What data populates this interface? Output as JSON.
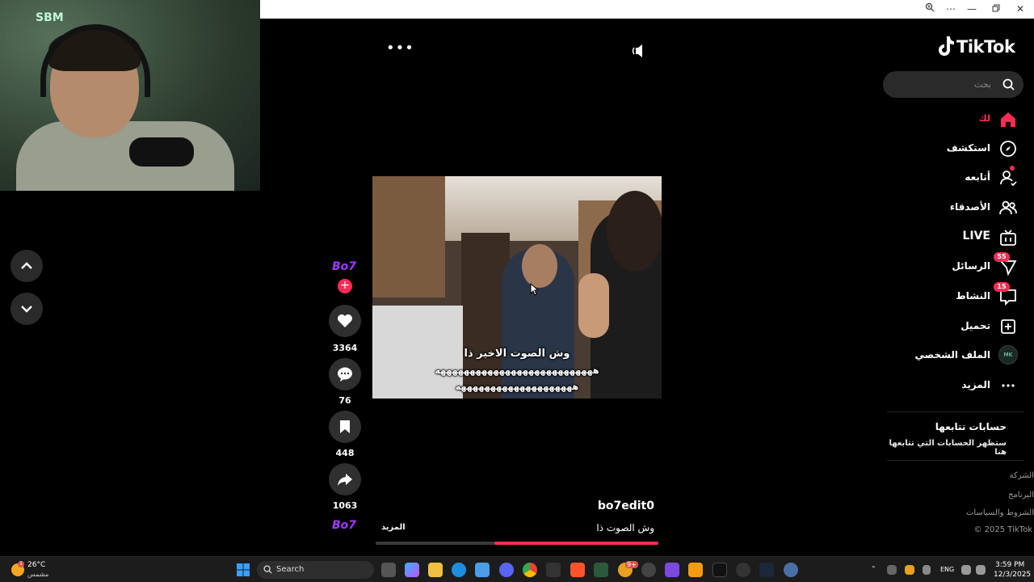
{
  "webcam": {
    "logo_text": "SBM"
  },
  "sidebar": {
    "brand": "TikTok",
    "search_placeholder": "بحث",
    "items": [
      {
        "label": "لك",
        "icon": "home-icon",
        "active": true
      },
      {
        "label": "استكشف",
        "icon": "compass-icon"
      },
      {
        "label": "أتابعه",
        "icon": "following-icon"
      },
      {
        "label": "الأصدقاء",
        "icon": "friends-icon"
      },
      {
        "label": "LIVE",
        "icon": "live-icon"
      },
      {
        "label": "الرسائل",
        "icon": "messages-icon",
        "badge": "55"
      },
      {
        "label": "النشاط",
        "icon": "activity-icon",
        "badge": "15"
      },
      {
        "label": "تحميل",
        "icon": "upload-icon"
      },
      {
        "label": "الملف الشخصي",
        "icon": "profile-avatar"
      },
      {
        "label": "المزيد",
        "icon": "more-icon"
      }
    ],
    "following_title": "حسابات تتابعها",
    "following_sub": "ستظهر الحسابات التي تتابعها هنا",
    "footer": [
      "الشركة",
      "البرنامج",
      "الشروط والسياسات"
    ],
    "copyright": "© 2025 TikTok",
    "profile_avatar_text": "MK"
  },
  "video": {
    "subtitle_line1": "وش الصوت الاخير ذا",
    "subtitle_line2": "هههههههههههههههههههههههههههه",
    "subtitle_line3": "ههههههههههههههههههههه",
    "author": "bo7edit0",
    "caption": "وش الصوت ذا",
    "more_label": "المزيد",
    "avatar_text": "Bo7",
    "progress_fraction": 0.58
  },
  "actions": {
    "likes": "3364",
    "comments": "76",
    "saves": "448",
    "shares": "1063"
  },
  "taskbar": {
    "temperature": "26°C",
    "weather_condition": "مشمس",
    "weather_badge": "1",
    "search_label": "Search",
    "language": "ENG",
    "time": "3:59 PM",
    "date": "12/3/2025",
    "badge_app1": "9+"
  }
}
